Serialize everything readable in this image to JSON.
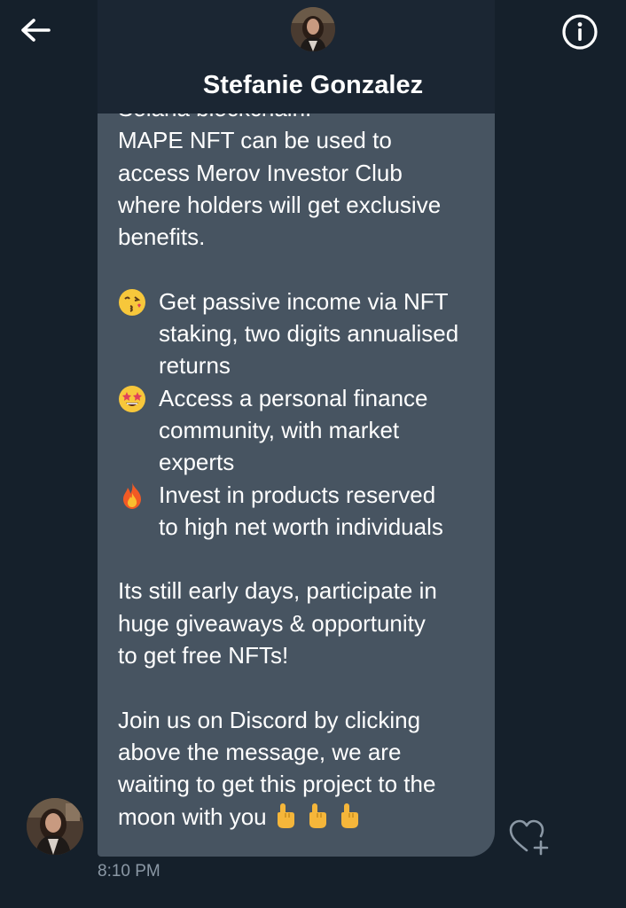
{
  "header": {
    "contact_name": "Stefanie Gonzalez",
    "back_icon": "arrow-left-icon",
    "info_icon": "info-circle-icon"
  },
  "message": {
    "line1": "Solana blockchain.",
    "para1": "MAPE NFT can be used to\naccess Merov Investor Club\nwhere holders will get exclusive\nbenefits.",
    "bullet1": "Get passive income via NFT\nstaking, two digits annualised\nreturns",
    "bullet1_emoji": "😘",
    "bullet2": "Access a personal finance\ncommunity, with market\nexperts",
    "bullet2_emoji": "🤩",
    "bullet3": "Invest in products reserved\nto high net worth individuals",
    "bullet3_emoji": "🔥",
    "para2": "Its still early days, participate in\nhuge giveaways & opportunity\nto get free NFTs!",
    "para3": "Join us on Discord by clicking\nabove the message, we are\nwaiting to get this project to the\nmoon with you",
    "para3_emojis": "👆 👆 👆",
    "timestamp": "8:10 PM"
  },
  "colors": {
    "background": "#15202b",
    "bubble": "#475461",
    "timestamp": "#8b98a5"
  }
}
